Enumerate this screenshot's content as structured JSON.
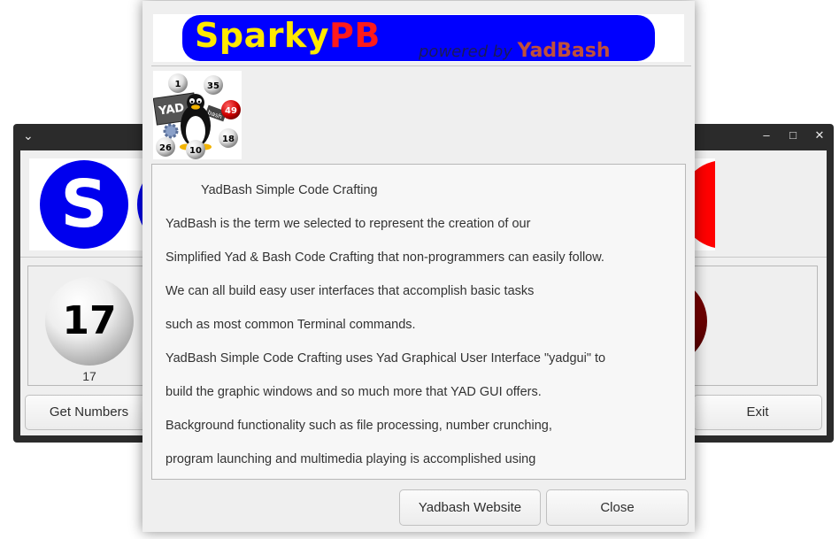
{
  "background_window": {
    "banner_letter": "S",
    "ball_number": "17",
    "ball_label": "17",
    "get_numbers_label": "Get Numbers",
    "exit_label": "Exit"
  },
  "dialog": {
    "logo": {
      "part1": "Sparky",
      "part2": "PB",
      "powered_prefix": "powered by ",
      "powered_name": "YadBash"
    },
    "icon": {
      "tag": "YAD",
      "balls": [
        "1",
        "35",
        "49",
        "26",
        "10",
        "18"
      ],
      "bash_tag": "bash"
    },
    "text_lines": [
      "YadBash Simple Code Crafting",
      "YadBash is the term we selected to represent the creation of our",
      "Simplified Yad & Bash Code Crafting that non-programmers can easily follow.",
      "We can all build easy user interfaces that accomplish basic tasks",
      "such as most common Terminal commands.",
      "YadBash Simple Code Crafting uses Yad Graphical User Interface \"yadgui\" to",
      "build the graphic windows and so much more that YAD GUI offers.",
      "Background functionality such as file processing, number crunching,",
      "program launching and multimedia playing is accomplished using"
    ],
    "website_button": "Yadbash Website",
    "close_button": "Close"
  },
  "colors": {
    "banner_blue": "#0000ff",
    "logo_yellow": "#ffe800",
    "logo_red": "#ff1a1a",
    "yadbash_orange": "#c0503a"
  }
}
